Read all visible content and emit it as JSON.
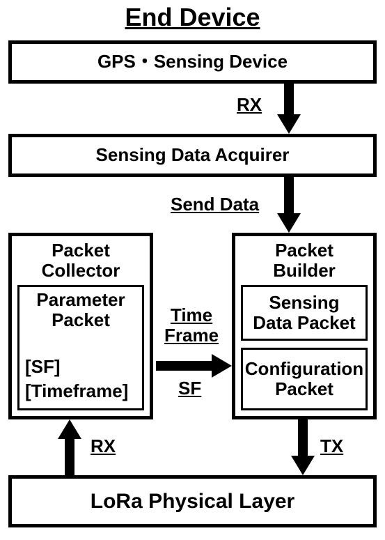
{
  "title": "End Device",
  "gps_box": "GPS・Sensing Device",
  "acquirer_box": "Sensing Data Acquirer",
  "lora_box": "LoRa Physical Layer",
  "collector": {
    "title": "Packet\nCollector",
    "param_title": "Parameter\nPacket",
    "sf": "[SF]",
    "tf": "[Timeframe]"
  },
  "builder": {
    "title": "Packet\nBuilder",
    "sdp": "Sensing\nData Packet",
    "cfg": "Configuration\nPacket"
  },
  "labels": {
    "rx1": "RX",
    "send_data": "Send Data",
    "time_frame": "Time\nFrame",
    "sf": "SF",
    "rx2": "RX",
    "tx": "TX"
  }
}
